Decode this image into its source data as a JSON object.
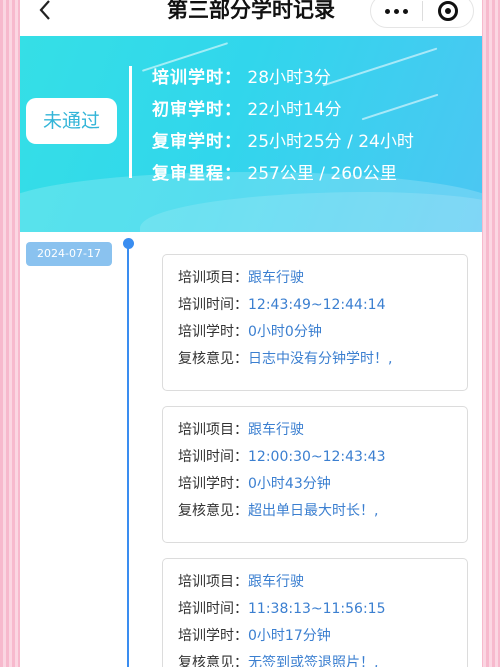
{
  "nav": {
    "title": "第三部分学时记录"
  },
  "summary": {
    "status": "未通过",
    "rows": [
      {
        "label": "培训学时：",
        "value": "28小时3分"
      },
      {
        "label": "初审学时：",
        "value": "22小时14分"
      },
      {
        "label": "复审学时：",
        "value": "25小时25分 / 24小时"
      },
      {
        "label": "复审里程：",
        "value": "257公里 / 260公里"
      }
    ]
  },
  "timeline": {
    "date": "2024-07-17",
    "records": [
      {
        "project_label": "培训项目：",
        "project": "跟车行驶",
        "time_label": "培训时间：",
        "time": "12:43:49~12:44:14",
        "hours_label": "培训学时：",
        "hours": "0小时0分钟",
        "review_label": "复核意见：",
        "review": "日志中没有分钟学时！,"
      },
      {
        "project_label": "培训项目：",
        "project": "跟车行驶",
        "time_label": "培训时间：",
        "time": "12:00:30~12:43:43",
        "hours_label": "培训学时：",
        "hours": "0小时43分钟",
        "review_label": "复核意见：",
        "review": "超出单日最大时长！,"
      },
      {
        "project_label": "培训项目：",
        "project": "跟车行驶",
        "time_label": "培训时间：",
        "time": "11:38:13~11:56:15",
        "hours_label": "培训学时：",
        "hours": "0小时17分钟",
        "review_label": "复核意见：",
        "review": "无签到或签退照片！,"
      }
    ]
  }
}
